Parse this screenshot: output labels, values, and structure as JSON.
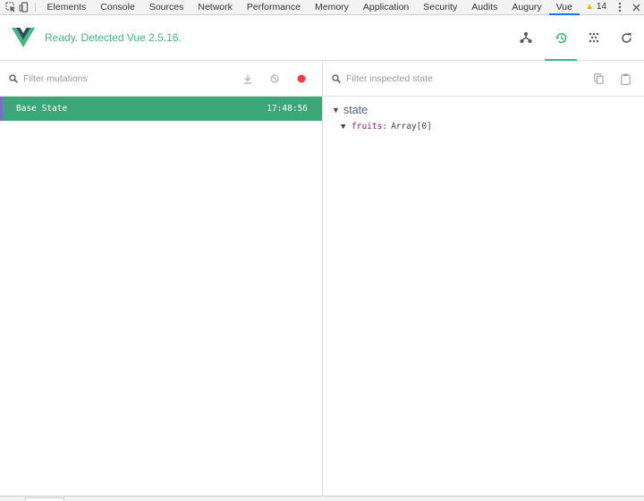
{
  "devtools": {
    "tabs": [
      {
        "label": "Elements",
        "active": false
      },
      {
        "label": "Console",
        "active": false
      },
      {
        "label": "Sources",
        "active": false
      },
      {
        "label": "Network",
        "active": false
      },
      {
        "label": "Performance",
        "active": false
      },
      {
        "label": "Memory",
        "active": false
      },
      {
        "label": "Application",
        "active": false
      },
      {
        "label": "Security",
        "active": false
      },
      {
        "label": "Audits",
        "active": false
      },
      {
        "label": "Augury",
        "active": false
      },
      {
        "label": "Vue",
        "active": true
      }
    ],
    "warning_count": "14",
    "icons": {
      "inspect": "cursor-select-icon",
      "device": "device-toggle-icon",
      "warning": "warning-triangle-icon",
      "menu": "kebab-menu-icon",
      "close": "close-icon"
    }
  },
  "vue": {
    "status_text": "Ready. Detected Vue 2.5.16.",
    "brand_color": "#42b983",
    "header_buttons": [
      {
        "name": "components-tab",
        "icon": "tree-icon",
        "active": false
      },
      {
        "name": "vuex-tab",
        "icon": "history-icon",
        "active": true
      },
      {
        "name": "events-tab",
        "icon": "events-dots-icon",
        "active": false
      },
      {
        "name": "refresh",
        "icon": "refresh-icon",
        "active": false
      }
    ]
  },
  "mutations": {
    "filter_placeholder": "Filter mutations",
    "entries": [
      {
        "label": "Base State",
        "time": "17:48:56",
        "selected": true
      }
    ],
    "entry_color": "#3ba776",
    "record_color": "#f03e3e"
  },
  "inspector": {
    "filter_placeholder": "Filter inspected state",
    "section_title": "state",
    "items": [
      {
        "key": "fruits",
        "value": "Array[0]"
      }
    ]
  }
}
